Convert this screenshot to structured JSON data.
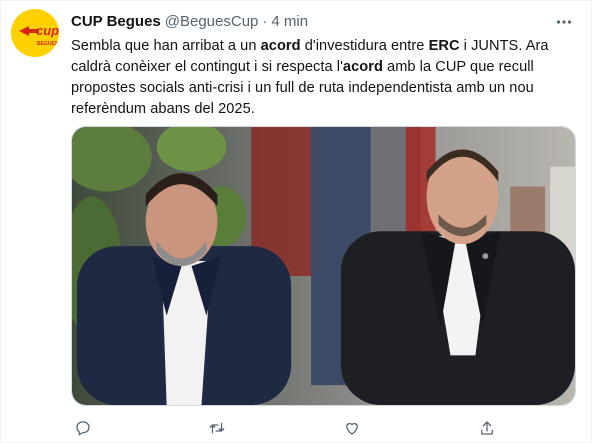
{
  "tweet": {
    "display_name": "CUP Begues",
    "handle": "@BeguesCup",
    "separator": "·",
    "time": "4 min",
    "avatar_text": "cup",
    "avatar_sub": "BEGUES",
    "text": {
      "p1": "Sembla que han arribat a un ",
      "b1": "acord",
      "p2": " d'investidura entre ",
      "b2": "ERC",
      "p3": " i JUNTS. Ara caldrà conèixer el contingut i si respecta l'",
      "b3": "acord",
      "p4": " amb la CUP que recull propostes socials anti-crisi i  un full de ruta independentista amb un nou referèndum abans del 2025."
    }
  },
  "icons": {
    "more": "more-icon",
    "reply": "reply-icon",
    "retweet": "retweet-icon",
    "like": "like-icon",
    "share": "share-icon"
  },
  "colors": {
    "text": "#0f1419",
    "secondary": "#536471",
    "cup_yellow": "#ffd100",
    "cup_red": "#d62718"
  }
}
